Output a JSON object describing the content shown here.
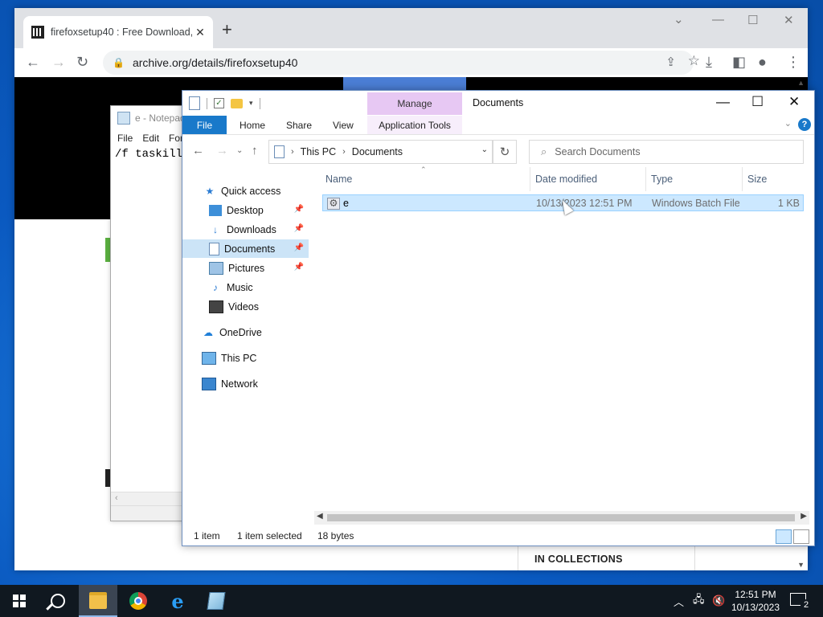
{
  "browser": {
    "tab_title": "firefoxsetup40 : Free Download,",
    "tab_close": "✕",
    "new_tab": "+",
    "url": "archive.org/details/firefoxsetup40",
    "controls": {
      "minimize": "—",
      "maximize": "☐",
      "close": "✕",
      "tabsearch": "⌄"
    }
  },
  "page": {
    "collections_heading": "IN COLLECTIONS"
  },
  "notepad": {
    "title": "e - Notepad",
    "menu": [
      "File",
      "Edit",
      "Format"
    ],
    "text": "/f taskill"
  },
  "explorer": {
    "title": "Documents",
    "contextual_tab": "Manage",
    "ribbon": {
      "file": "File",
      "home": "Home",
      "share": "Share",
      "view": "View",
      "app_tools": "Application Tools"
    },
    "breadcrumb": [
      "This PC",
      "Documents"
    ],
    "search_placeholder": "Search Documents",
    "nav": {
      "quick_access": "Quick access",
      "desktop": "Desktop",
      "downloads": "Downloads",
      "documents": "Documents",
      "pictures": "Pictures",
      "music": "Music",
      "videos": "Videos",
      "onedrive": "OneDrive",
      "this_pc": "This PC",
      "network": "Network"
    },
    "columns": {
      "name": "Name",
      "date": "Date modified",
      "type": "Type",
      "size": "Size"
    },
    "files": [
      {
        "name": "e",
        "date": "10/13/2023 12:51 PM",
        "type": "Windows Batch File",
        "size": "1 KB"
      }
    ],
    "status": {
      "count": "1 item",
      "selected": "1 item selected",
      "size": "18 bytes"
    }
  },
  "taskbar": {
    "time": "12:51 PM",
    "date": "10/13/2023",
    "notifications": "2"
  }
}
